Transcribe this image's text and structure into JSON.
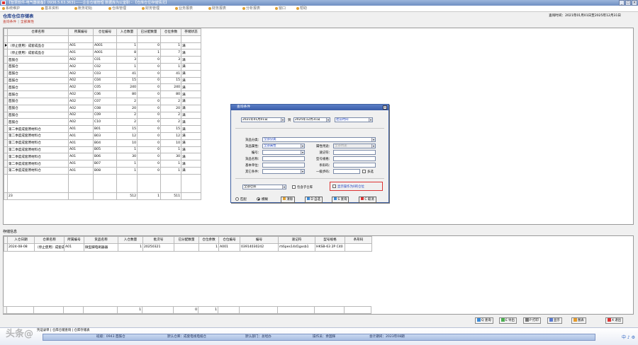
{
  "window": {
    "title": "【智慧软件-电气器装备】0936.5.63.3631——企业仓储管理 数据库为公室职 - 【仓库仓位存储情况】",
    "buttons": [
      "_",
      "□",
      "×"
    ]
  },
  "menu": [
    "系统维护",
    "基本资料",
    "账务初始",
    "仓库管理",
    "财务管理",
    "业务报表",
    "财务报表",
    "分析报表",
    "窗口",
    "帮助"
  ],
  "module": {
    "title": "仓库仓位存储表",
    "query_date": "查询时间：2021年01月01日至2025年12月31日",
    "tabs": [
      "查询条件",
      "全部属性"
    ]
  },
  "main_table": {
    "columns": [
      "仓库名称",
      "所属编号",
      "仓位编号",
      "入仓数量",
      "已分配数量",
      "仓位余数",
      "存储状态"
    ],
    "rows": [
      [
        "（停止使用）成套成品仓",
        "A01",
        "A001",
        "1",
        "0",
        "1",
        "满"
      ],
      [
        "（停止使用）成套成品仓",
        "A01",
        "A001",
        "8",
        "1",
        "7",
        "满"
      ],
      [
        "酉鼓仓",
        "A02",
        "C01",
        "3",
        "0",
        "3",
        "满"
      ],
      [
        "酉鼓仓",
        "A02",
        "C02",
        "1",
        "0",
        "1",
        "满"
      ],
      [
        "酉鼓仓",
        "A02",
        "C03",
        "41",
        "0",
        "41",
        "满"
      ],
      [
        "酉鼓仓",
        "A02",
        "C04",
        "15",
        "0",
        "15",
        "满"
      ],
      [
        "酉鼓仓",
        "A02",
        "C05",
        "240",
        "0",
        "240",
        "满"
      ],
      [
        "酉鼓仓",
        "A02",
        "C06",
        "80",
        "0",
        "80",
        "满"
      ],
      [
        "酉鼓仓",
        "A02",
        "C07",
        "2",
        "0",
        "2",
        "满"
      ],
      [
        "酉鼓仓",
        "A02",
        "C08",
        "20",
        "0",
        "20",
        "满"
      ],
      [
        "酉鼓仓",
        "A02",
        "C09",
        "2",
        "0",
        "2",
        "满"
      ],
      [
        "酉鼓仓",
        "A02",
        "C10",
        "2",
        "0",
        "2",
        "满"
      ],
      [
        "第二季度成套原材料仓",
        "A01",
        "B01",
        "15",
        "0",
        "15",
        "满"
      ],
      [
        "第二季度成套原材料仓",
        "A01",
        "B03",
        "12",
        "0",
        "12",
        "满"
      ],
      [
        "第二季度成套原材料仓",
        "A01",
        "B04",
        "10",
        "0",
        "10",
        "满"
      ],
      [
        "第二季度成套原材料仓",
        "A01",
        "B05",
        "1",
        "0",
        "1",
        "满"
      ],
      [
        "第二季度成套原材料仓",
        "A01",
        "B06",
        "30",
        "0",
        "30",
        "满"
      ],
      [
        "第二季度成套原材料仓",
        "A01",
        "B07",
        "1",
        "0",
        "1",
        "满"
      ],
      [
        "第二季度成套原材料仓",
        "A01",
        "B08",
        "1",
        "0",
        "1",
        "满"
      ]
    ],
    "totals": [
      "23",
      "",
      "",
      "512",
      "1",
      "511",
      ""
    ]
  },
  "stock_section": {
    "label": "存储信息",
    "columns": [
      "入仓日期",
      "仓库名称",
      "所属编号",
      "货品名称",
      "入仓数量",
      "批次号",
      "已分配数量",
      "仓位余数",
      "仓位编号",
      "编号",
      "速记符",
      "型号规格",
      "条形码"
    ],
    "rows": [
      [
        "2024-08-08",
        "（停止使用）成套成",
        "A01",
        "微型脚电刷器器",
        "1",
        "20250321",
        "",
        "1",
        "A001",
        "03914030242",
        "rt4ipes14d1gxsb1",
        "HKSB-63 2P C40",
        ""
      ]
    ],
    "totals": [
      "",
      "",
      "",
      "",
      "1",
      "",
      "0",
      "1",
      "",
      "",
      "",
      "",
      ""
    ]
  },
  "toolbar": [
    {
      "icon": "query-icon",
      "label": "Q 查询"
    },
    {
      "icon": "export-icon",
      "label": "E 导出"
    },
    {
      "icon": "print-icon",
      "label": "P 打印"
    },
    {
      "icon": "display-icon",
      "label": "显示"
    },
    {
      "icon": "chart-icon",
      "label": "图表"
    },
    {
      "icon": "exit-icon",
      "label": "X 退出"
    }
  ],
  "dialog": {
    "title": "查询条件",
    "date_from": "2021年01月01日",
    "date_to_label": "到",
    "date_to": "2025年12月31日",
    "period": "往前时间",
    "labels": {
      "category": "货品分类：",
      "attribute": "货品属性：",
      "purpose": "属性用途：",
      "code": "编号：",
      "shorthand": "速记符：",
      "name": "货品名称：",
      "model": "型号规格：",
      "unit": "基本单位：",
      "barcode": "条形码：",
      "other": "其它条件：",
      "level": "一级步码："
    },
    "values": {
      "category": "全部分类",
      "attribute": "全部属性",
      "purpose": "全部用途"
    },
    "multi_label": "多选",
    "warehouse": "全部仓库",
    "include_child": "包含子仓库",
    "show_hint": "显示操作为0的仓位",
    "match_options": [
      "匹配",
      "模糊"
    ],
    "buttons": [
      "清除",
      "D 自选",
      "S 查询",
      "C 取消"
    ]
  },
  "taskbar": {
    "watermark": "头条@",
    "tabs": [
      "凭证录单",
      "仓库仓储查询",
      "仓库存储表"
    ],
    "status": [
      {
        "label": "班级：",
        "value": "0943 酉鼓仓"
      },
      {
        "label": "默认仓库：",
        "value": "成套电线电缆仓"
      },
      {
        "label": "默认部门：",
        "value": "总经办"
      },
      {
        "label": "操作员：",
        "value": "余国辉"
      },
      {
        "label": "会计期间：",
        "value": "2023年08期"
      }
    ],
    "tray": "中 ♪ ⚙"
  }
}
